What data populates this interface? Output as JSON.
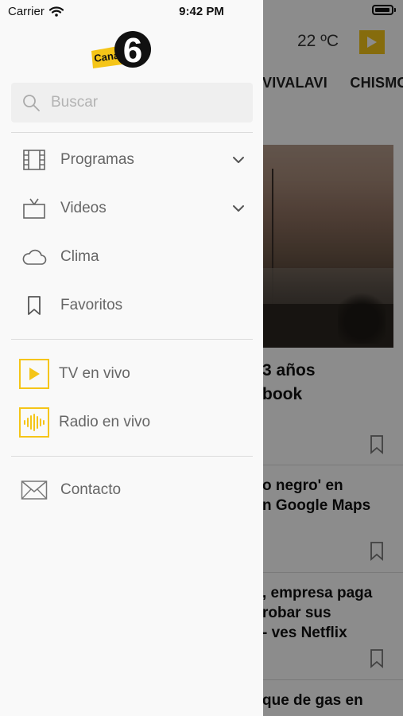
{
  "status": {
    "carrier": "Carrier",
    "time": "9:42 PM"
  },
  "header": {
    "temperature": "22 ºC"
  },
  "tabs": [
    "VIVALAVI",
    "CHISMO"
  ],
  "articles": [
    {
      "lines": [
        "3 años",
        "book"
      ]
    },
    {
      "lines": [
        "o negro' en",
        "n Google Maps"
      ]
    },
    {
      "lines": [
        ", empresa paga",
        "robar sus",
        "- ves Netflix"
      ]
    },
    {
      "lines": [
        "que de gas en"
      ]
    }
  ],
  "drawer": {
    "logo_text": "Canal",
    "logo_number": "6",
    "search": {
      "placeholder": "Buscar"
    },
    "items": [
      {
        "label": "Programas",
        "icon": "film-icon",
        "expandable": true
      },
      {
        "label": "Videos",
        "icon": "tv-icon",
        "expandable": true
      },
      {
        "label": "Clima",
        "icon": "cloud-icon",
        "expandable": false
      },
      {
        "label": "Favoritos",
        "icon": "bookmark-icon",
        "expandable": false
      }
    ],
    "live_items": [
      {
        "label": "TV en vivo",
        "icon": "play-icon"
      },
      {
        "label": "Radio en vivo",
        "icon": "audio-wave-icon"
      }
    ],
    "contact": {
      "label": "Contacto",
      "icon": "envelope-icon"
    }
  },
  "colors": {
    "accent": "#f5c518",
    "drawer_bg": "#f9f9f9",
    "label": "#666666"
  }
}
